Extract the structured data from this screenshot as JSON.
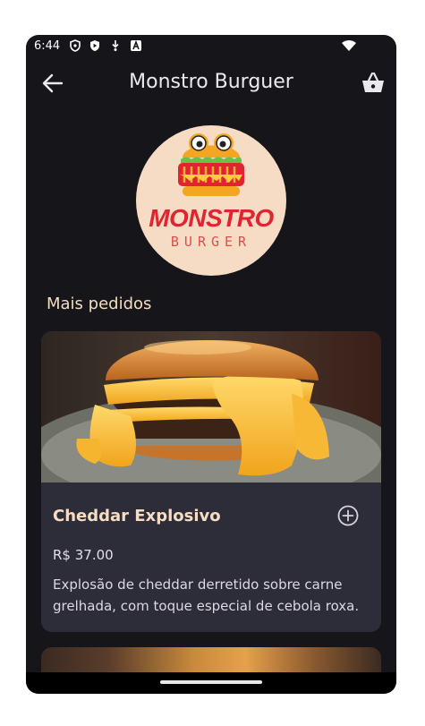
{
  "status_bar": {
    "time": "6:44",
    "icons": [
      "shield-icon",
      "play-protect-icon",
      "download-icon",
      "a-badge-icon",
      "wifi-icon"
    ]
  },
  "app_bar": {
    "title": "Monstro Burguer",
    "back_icon": "arrow-left-icon",
    "cart_icon": "basket-icon"
  },
  "logo": {
    "line1": "MONSTRO",
    "line2": "BURGER"
  },
  "section": {
    "title": "Mais pedidos"
  },
  "products": [
    {
      "name": "Cheddar Explosivo",
      "price": "R$ 37.00",
      "description": "Explosão de cheddar derretido sobre carne grelhada, com toque especial de cebola roxa.",
      "add_icon": "add-circle-icon"
    }
  ],
  "colors": {
    "background": "#16151a",
    "card": "#2d2d39",
    "accent_text": "#f6dcc2",
    "logo_circle": "#f6dcc5",
    "logo_red": "#e02430"
  }
}
